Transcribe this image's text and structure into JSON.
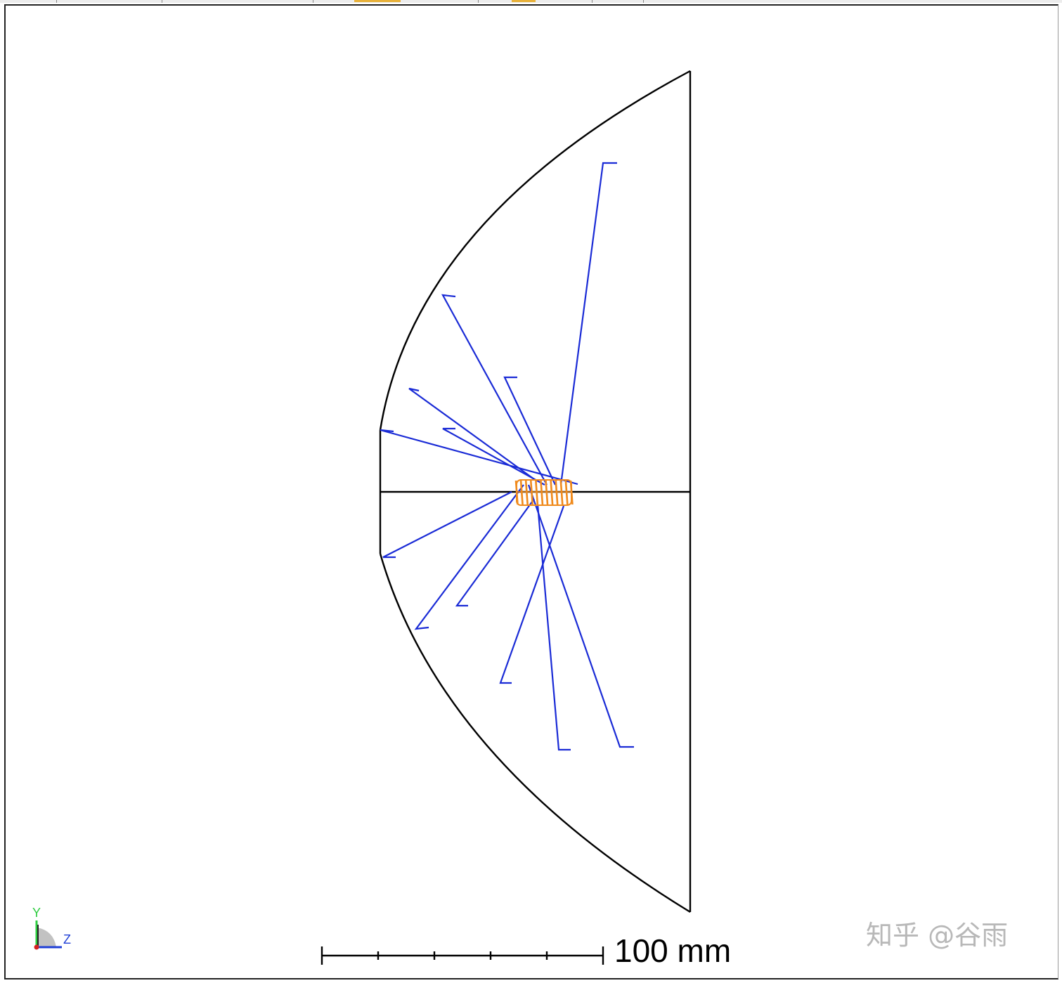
{
  "scale_bar": {
    "label": "100 mm"
  },
  "triad": {
    "y_label": "Y",
    "z_label": "Z",
    "y_color": "#2ecc40",
    "z_color": "#1f3fd6",
    "x_color": "#d62020"
  },
  "watermark": {
    "text": "知乎 @谷雨"
  },
  "colors": {
    "outline": "#000000",
    "ray": "#1a2bd6",
    "source": "#f08a1c",
    "background": "#ffffff"
  }
}
